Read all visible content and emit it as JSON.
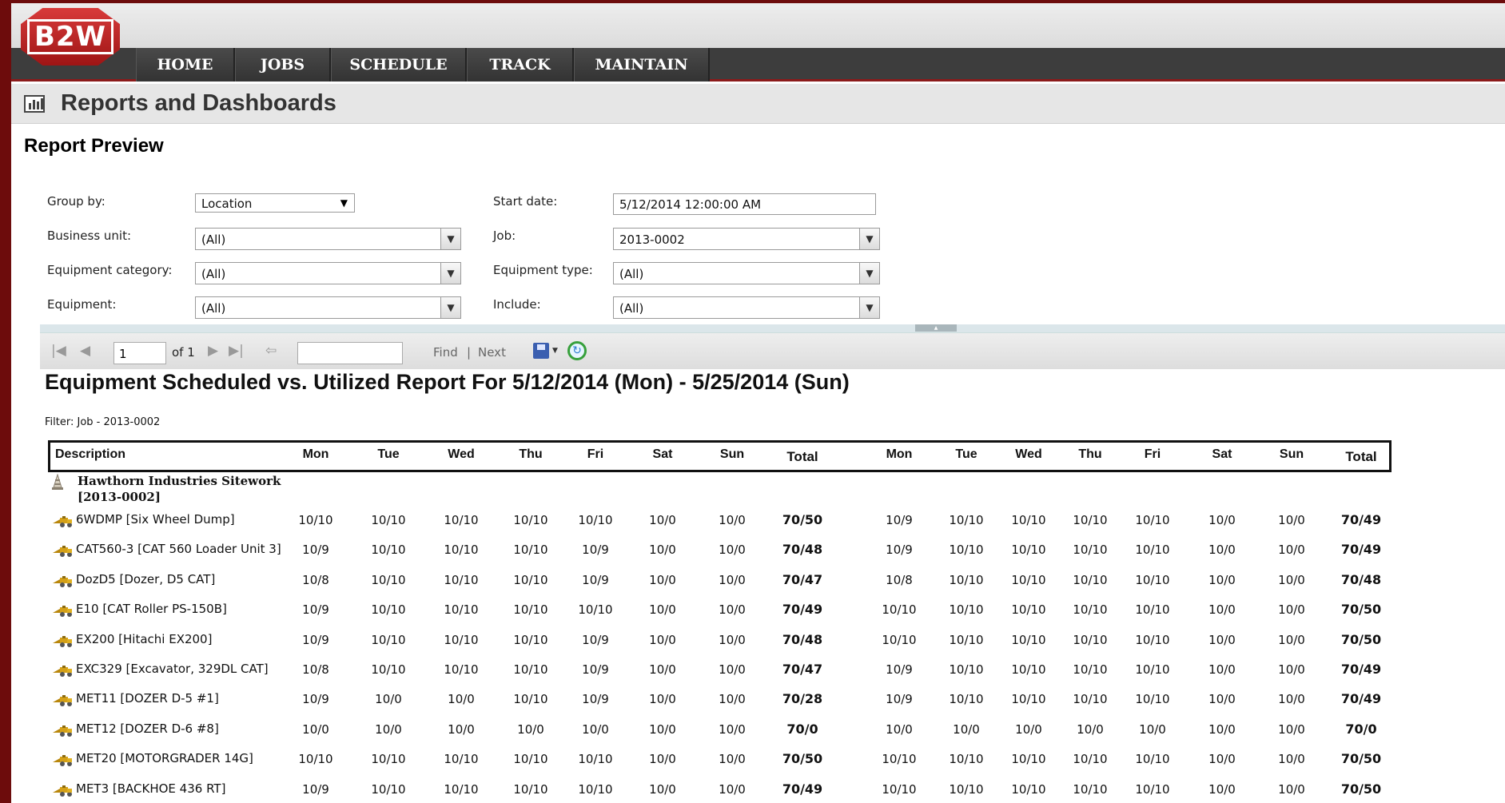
{
  "app": {
    "logo_text": "B2W"
  },
  "nav": {
    "items": [
      "HOME",
      "JOBS",
      "SCHEDULE",
      "TRACK",
      "MAINTAIN"
    ]
  },
  "page": {
    "title": "Reports and Dashboards",
    "section": "Report Preview"
  },
  "params": {
    "group_by": {
      "label": "Group by:",
      "value": "Location"
    },
    "start_date": {
      "label": "Start date:",
      "value": "5/12/2014 12:00:00 AM"
    },
    "business_unit": {
      "label": "Business unit:",
      "value": "(All)"
    },
    "job": {
      "label": "Job:",
      "value": "2013-0002"
    },
    "equipment_category": {
      "label": "Equipment category:",
      "value": "(All)"
    },
    "equipment_type": {
      "label": "Equipment type:",
      "value": "(All)"
    },
    "equipment": {
      "label": "Equipment:",
      "value": "(All)"
    },
    "include": {
      "label": "Include:",
      "value": "(All)"
    }
  },
  "toolbar": {
    "page": "1",
    "of_label": "of 1",
    "find_label": "Find",
    "separator": "|",
    "next_label": "Next"
  },
  "report": {
    "title": "Equipment Scheduled vs. Utilized Report For 5/12/2014 (Mon) - 5/25/2014 (Sun)",
    "filter": "Filter: Job - 2013-0002",
    "columns": [
      "Description",
      "Mon",
      "Tue",
      "Wed",
      "Thu",
      "Fri",
      "Sat",
      "Sun",
      "Total",
      "Mon",
      "Tue",
      "Wed",
      "Thu",
      "Fri",
      "Sat",
      "Sun",
      "Total"
    ],
    "group": {
      "line1": "Hawthorn Industries Sitework",
      "line2": "[2013-0002]"
    },
    "rows": [
      {
        "desc": "6WDMP [Six Wheel Dump]",
        "cells": [
          "10/10",
          "10/10",
          "10/10",
          "10/10",
          "10/10",
          "10/0",
          "10/0",
          "70/50",
          "10/9",
          "10/10",
          "10/10",
          "10/10",
          "10/10",
          "10/0",
          "10/0",
          "70/49"
        ]
      },
      {
        "desc": "CAT560-3 [CAT 560 Loader Unit 3]",
        "cells": [
          "10/9",
          "10/10",
          "10/10",
          "10/10",
          "10/9",
          "10/0",
          "10/0",
          "70/48",
          "10/9",
          "10/10",
          "10/10",
          "10/10",
          "10/10",
          "10/0",
          "10/0",
          "70/49"
        ]
      },
      {
        "desc": "DozD5 [Dozer, D5 CAT]",
        "cells": [
          "10/8",
          "10/10",
          "10/10",
          "10/10",
          "10/9",
          "10/0",
          "10/0",
          "70/47",
          "10/8",
          "10/10",
          "10/10",
          "10/10",
          "10/10",
          "10/0",
          "10/0",
          "70/48"
        ]
      },
      {
        "desc": "E10 [CAT Roller PS-150B]",
        "cells": [
          "10/9",
          "10/10",
          "10/10",
          "10/10",
          "10/10",
          "10/0",
          "10/0",
          "70/49",
          "10/10",
          "10/10",
          "10/10",
          "10/10",
          "10/10",
          "10/0",
          "10/0",
          "70/50"
        ]
      },
      {
        "desc": "EX200 [Hitachi EX200]",
        "cells": [
          "10/9",
          "10/10",
          "10/10",
          "10/10",
          "10/9",
          "10/0",
          "10/0",
          "70/48",
          "10/10",
          "10/10",
          "10/10",
          "10/10",
          "10/10",
          "10/0",
          "10/0",
          "70/50"
        ]
      },
      {
        "desc": "EXC329 [Excavator, 329DL CAT]",
        "cells": [
          "10/8",
          "10/10",
          "10/10",
          "10/10",
          "10/9",
          "10/0",
          "10/0",
          "70/47",
          "10/9",
          "10/10",
          "10/10",
          "10/10",
          "10/10",
          "10/0",
          "10/0",
          "70/49"
        ]
      },
      {
        "desc": "MET11 [DOZER D-5 #1]",
        "cells": [
          "10/9",
          "10/0",
          "10/0",
          "10/10",
          "10/9",
          "10/0",
          "10/0",
          "70/28",
          "10/9",
          "10/10",
          "10/10",
          "10/10",
          "10/10",
          "10/0",
          "10/0",
          "70/49"
        ]
      },
      {
        "desc": "MET12 [DOZER D-6 #8]",
        "cells": [
          "10/0",
          "10/0",
          "10/0",
          "10/0",
          "10/0",
          "10/0",
          "10/0",
          "70/0",
          "10/0",
          "10/0",
          "10/0",
          "10/0",
          "10/0",
          "10/0",
          "10/0",
          "70/0"
        ]
      },
      {
        "desc": "MET20 [MOTORGRADER 14G]",
        "cells": [
          "10/10",
          "10/10",
          "10/10",
          "10/10",
          "10/10",
          "10/0",
          "10/0",
          "70/50",
          "10/10",
          "10/10",
          "10/10",
          "10/10",
          "10/10",
          "10/0",
          "10/0",
          "70/50"
        ]
      },
      {
        "desc": "MET3 [BACKHOE 436 RT]",
        "cells": [
          "10/9",
          "10/10",
          "10/10",
          "10/10",
          "10/10",
          "10/0",
          "10/0",
          "70/49",
          "10/10",
          "10/10",
          "10/10",
          "10/10",
          "10/10",
          "10/0",
          "10/0",
          "70/50"
        ]
      }
    ]
  }
}
